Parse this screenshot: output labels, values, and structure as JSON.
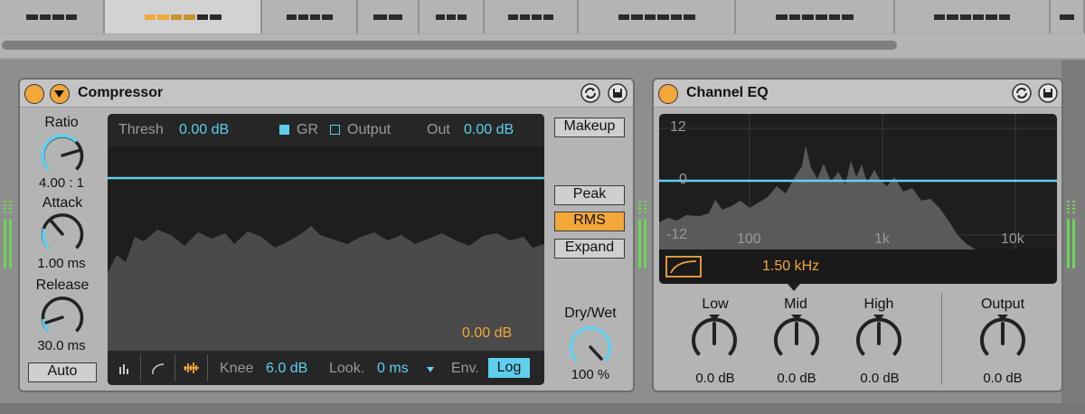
{
  "clips": [
    {
      "active": false
    },
    {
      "active": true
    },
    {
      "active": false
    },
    {
      "active": false
    },
    {
      "active": false
    },
    {
      "active": false
    },
    {
      "active": false
    },
    {
      "active": false
    },
    {
      "active": false
    },
    {
      "active": false
    }
  ],
  "compressor": {
    "title": "Compressor",
    "ratio": {
      "label": "Ratio",
      "value": "4.00 : 1"
    },
    "attack": {
      "label": "Attack",
      "value": "1.00 ms"
    },
    "release": {
      "label": "Release",
      "value": "30.0 ms"
    },
    "auto_label": "Auto",
    "display": {
      "thresh_label": "Thresh",
      "thresh_value": "0.00 dB",
      "gr_label": "GR",
      "output_label": "Output",
      "out_label": "Out",
      "out_value": "0.00 dB",
      "gr_readout": "0.00 dB",
      "knee_label": "Knee",
      "knee_value": "6.0 dB",
      "look_label": "Look.",
      "look_value": "0 ms",
      "env_label": "Env.",
      "env_value": "Log"
    },
    "makeup_label": "Makeup",
    "modes": {
      "peak": "Peak",
      "rms": "RMS",
      "expand": "Expand",
      "selected": "rms"
    },
    "drywet": {
      "label": "Dry/Wet",
      "value": "100 %",
      "fraction": 1.0
    },
    "colors": {
      "accent": "#f2a739",
      "blue": "#5ed0ee"
    }
  },
  "channel_eq": {
    "title": "Channel EQ",
    "y_labels": [
      "12",
      "0",
      "-12"
    ],
    "x_labels": [
      "100",
      "1k",
      "10k"
    ],
    "freq_readout": "1.50 kHz",
    "low": {
      "label": "Low",
      "value": "0.0 dB"
    },
    "mid": {
      "label": "Mid",
      "value": "0.0 dB"
    },
    "high": {
      "label": "High",
      "value": "0.0 dB"
    },
    "output": {
      "label": "Output",
      "value": "0.0 dB"
    }
  }
}
